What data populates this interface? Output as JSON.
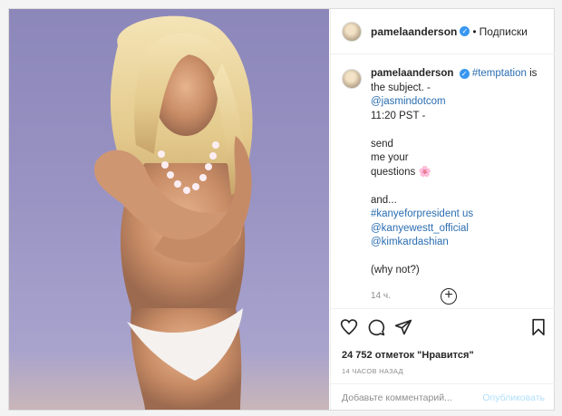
{
  "post": {
    "username": "pamelaanderson",
    "follow_label": "Подписки",
    "caption": {
      "hashtag_1": "#temptation",
      "text_1": " is",
      "line_2": "the subject. -",
      "mention_1": "@jasmindotcom",
      "line_4": "11:20 PST -",
      "line_6": "send",
      "line_7": "me your",
      "line_8": "questions",
      "line_8_emoji": "🌸",
      "line_10": "and...",
      "hashtag_2": "#kanyeforpresident us",
      "mention_2": "@kanyewestt_official",
      "mention_3": "@kimkardashian",
      "line_14": "(why not?)",
      "posted_ago": "14 ч."
    },
    "likes_text": "24 752 отметок \"Нравится\"",
    "time_ago": "14 ЧАСОВ НАЗАД",
    "comment_placeholder": "Добавьте комментарий...",
    "publish_label": "Опубликовать"
  },
  "icons": [
    "heart-icon",
    "comment-icon",
    "share-icon",
    "bookmark-icon",
    "add-reply-icon",
    "verified-badge-icon"
  ],
  "colors": {
    "link": "#2a6db0",
    "verified": "#3897f0",
    "publish_disabled": "#b2dffc",
    "photo_background": "#9a94c4"
  }
}
